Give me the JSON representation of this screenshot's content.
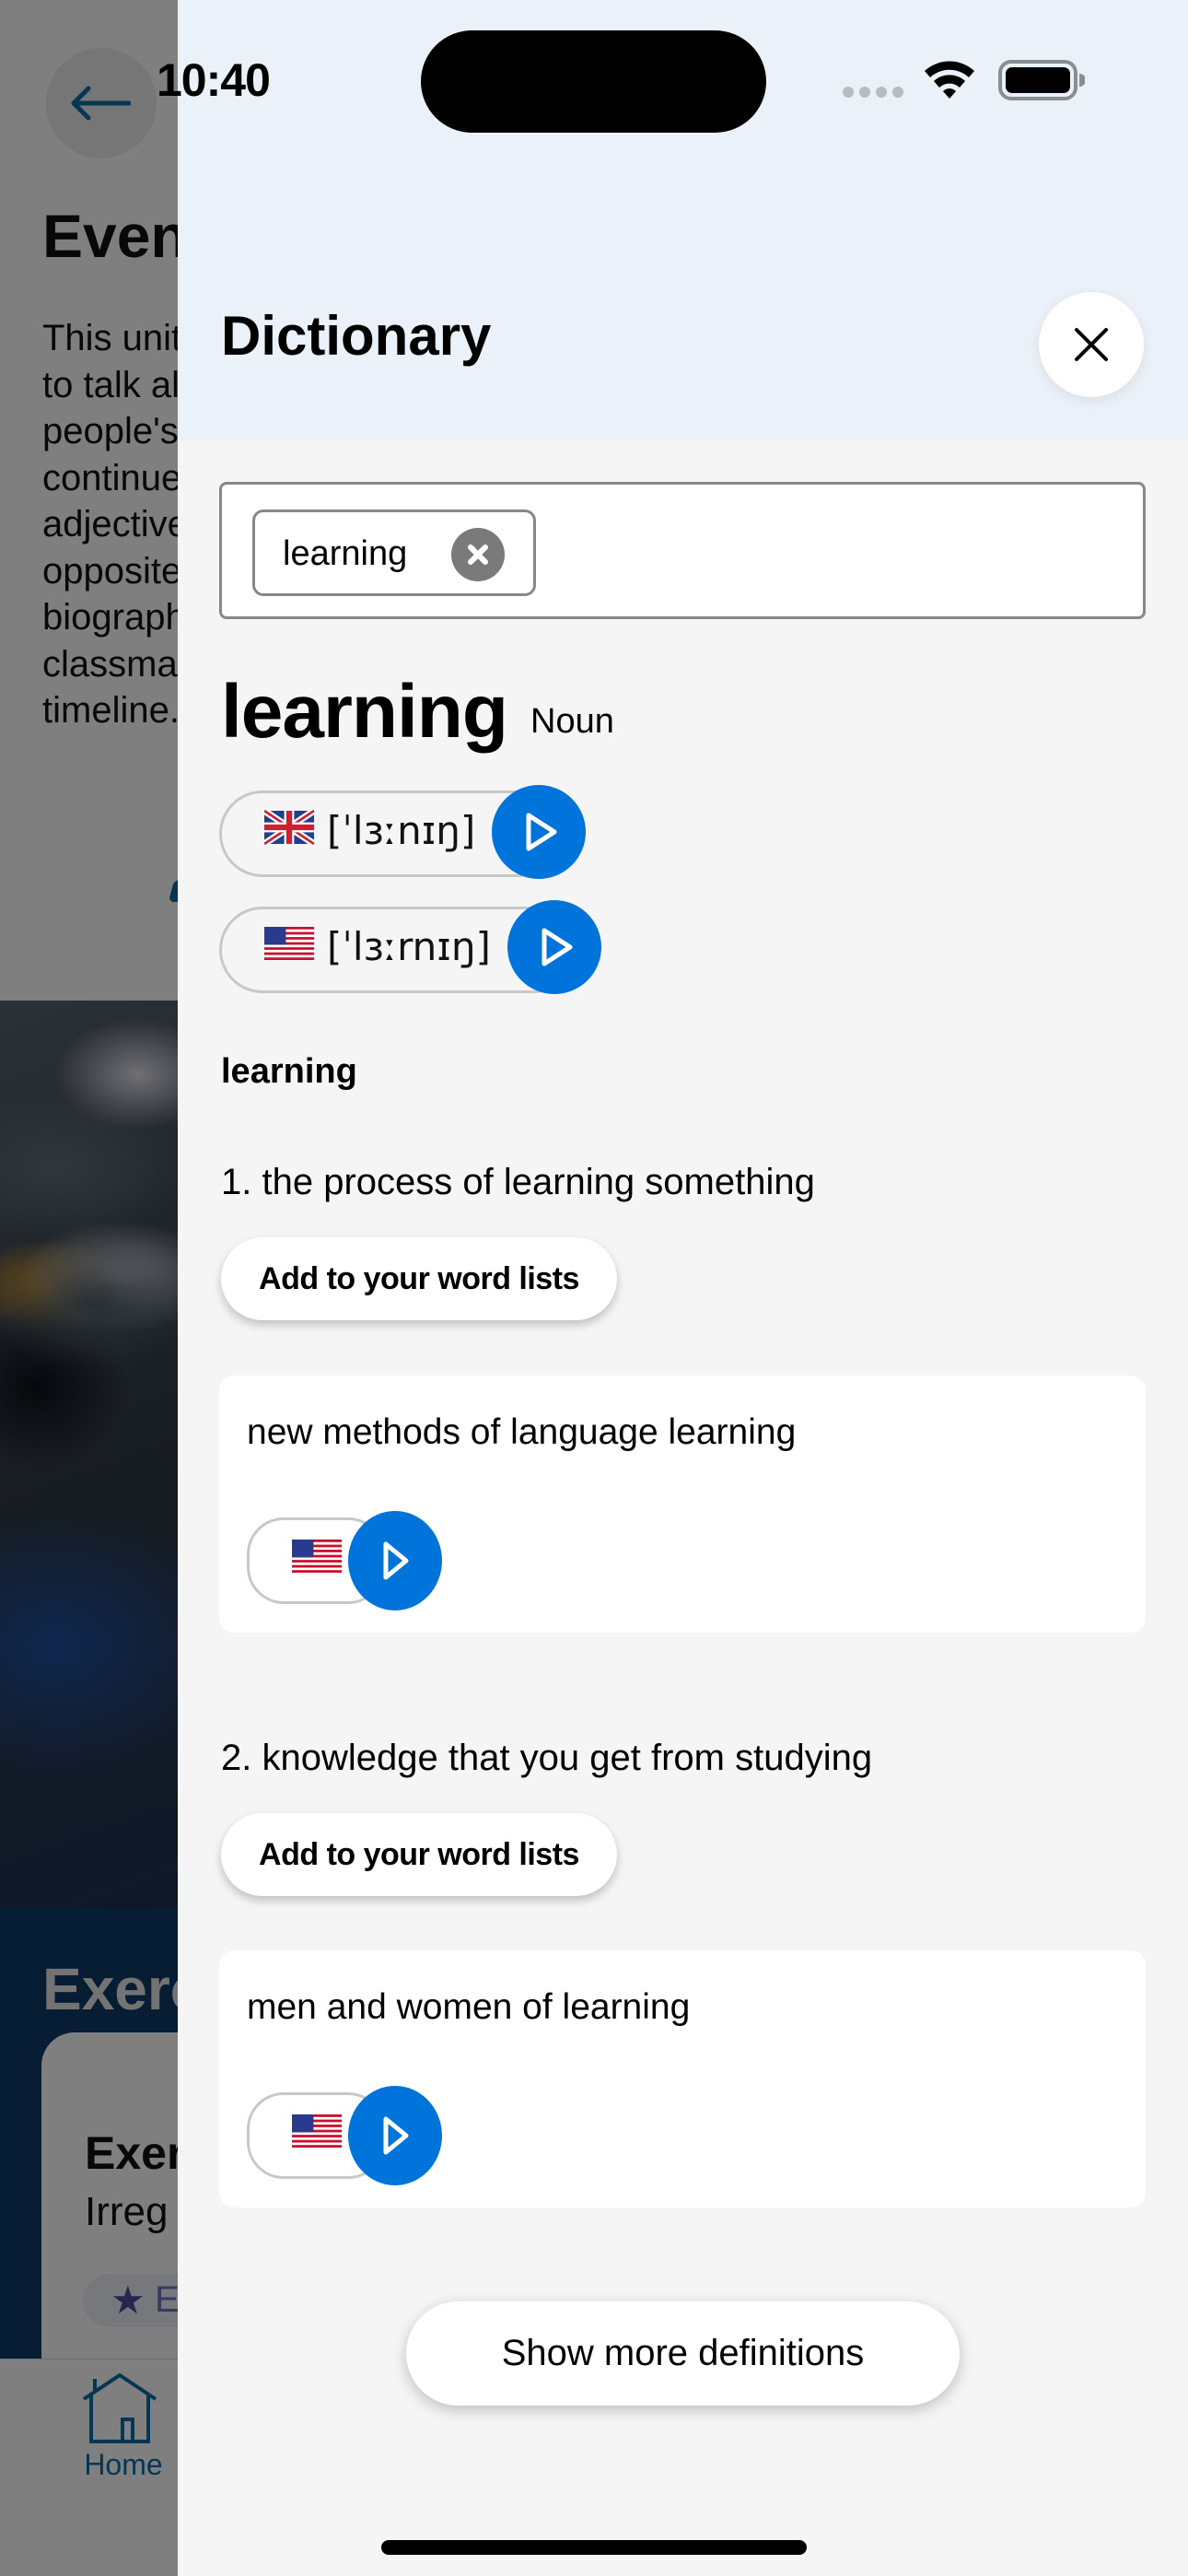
{
  "status_bar": {
    "time": "10:40",
    "icons": [
      "signal-dots-icon",
      "wifi-icon",
      "battery-icon"
    ]
  },
  "background_page": {
    "back_icon": "arrow-left-icon",
    "title": "Even",
    "description_lines": [
      "This unit",
      "to talk al",
      "people's",
      "continue",
      "adjective",
      "opposite",
      "biograph",
      "classmat",
      "timeline."
    ],
    "exercises_title": "Exerc",
    "card_title": "Exer",
    "card_subtitle": "Irreg",
    "card_badge": "E",
    "nav": {
      "home_label": "Home",
      "home_icon": "home-icon"
    }
  },
  "dictionary": {
    "title": "Dictionary",
    "close_icon": "close-icon",
    "search": {
      "chip_value": "learning",
      "chip_clear_icon": "clear-circle-icon"
    },
    "entry": {
      "headword": "learning",
      "part_of_speech": "Noun",
      "pronunciations": [
        {
          "accent": "UK",
          "flag": "uk-flag-icon",
          "ipa": "[ˈlɜːnɪŋ]",
          "play_icon": "play-icon"
        },
        {
          "accent": "US",
          "flag": "us-flag-icon",
          "ipa": "[ˈlɜːrnɪŋ]",
          "play_icon": "play-icon"
        }
      ],
      "sense_heading": "learning",
      "senses": [
        {
          "definition": "1. the process of learning something",
          "add_button": "Add to your word lists",
          "example": "new methods of language learning",
          "example_flag": "us-flag-icon"
        },
        {
          "definition": "2. knowledge that you get from studying",
          "add_button": "Add to your word lists",
          "example": "men and women of learning",
          "example_flag": "us-flag-icon"
        }
      ]
    },
    "show_more_button": "Show more definitions"
  },
  "colors": {
    "accent_blue": "#0074db",
    "header_bg": "#eaf1f8",
    "drawer_bg": "#f5f5f5",
    "nav_blue": "#0a6da8"
  }
}
